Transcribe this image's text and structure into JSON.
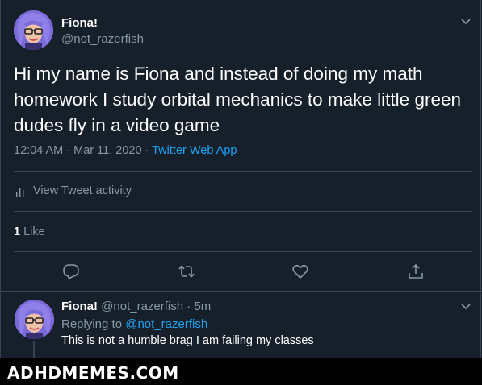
{
  "tweet": {
    "name": "Fiona!",
    "handle": "@not_razerfish",
    "text": "Hi my name is Fiona and instead of doing my math homework I study orbital mechanics to make little green dudes fly in a video game",
    "timestamp": "12:04 AM · Mar 11, 2020 · ",
    "source": "Twitter Web App",
    "activity_label": "View Tweet activity",
    "likes_count": "1",
    "likes_label": "Like"
  },
  "reply": {
    "name": "Fiona!",
    "handle_time": "@not_razerfish · 5m",
    "replying_prefix": "Replying to ",
    "replying_to": "@not_razerfish",
    "text": "This is not a humble brag I am failing my classes"
  },
  "watermark": {
    "text": "ADHDMEMES.COM"
  },
  "colors": {
    "background": "#15202b",
    "secondary_text": "#8899a6",
    "link": "#1da1f2",
    "divider": "#38444d",
    "avatar_hair": "#7b6bd8"
  },
  "icons": {
    "activity": "bar-chart-icon",
    "reply": "reply-icon",
    "retweet": "retweet-icon",
    "like": "heart-icon",
    "share": "share-icon",
    "more": "chevron-down-icon"
  }
}
